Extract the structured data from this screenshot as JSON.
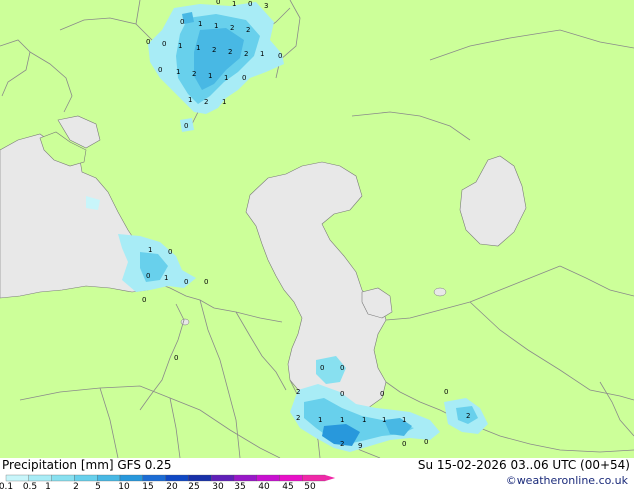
{
  "footer": {
    "title": "Precipitation [mm]  GFS 0.25",
    "datetime": "Su 15-02-2026 03..06 UTC (00+54)",
    "credit": "©weatheronline.co.uk"
  },
  "legend": {
    "ticks": [
      "0.1",
      "0.5",
      "1",
      "2",
      "5",
      "10",
      "15",
      "20",
      "25",
      "30",
      "35",
      "40",
      "45",
      "50"
    ],
    "colors": [
      "#c8f5fa",
      "#a8ecf6",
      "#88e0f0",
      "#68d0ec",
      "#48b8e4",
      "#2898dc",
      "#1c6cd4",
      "#1048c4",
      "#1830a8",
      "#6020b8",
      "#9818c8",
      "#c810d0",
      "#e810c8",
      "#f028a8"
    ]
  },
  "colors": {
    "land": "#ccff99",
    "water": "#e8e8e8",
    "border": "#8a8a8a",
    "coast": "#7a7a7a"
  },
  "precip_values": [
    {
      "text": "0"
    },
    {
      "text": "1"
    },
    {
      "text": "0"
    },
    {
      "text": "3"
    },
    {
      "text": "0"
    },
    {
      "text": "1"
    },
    {
      "text": "1"
    },
    {
      "text": "2"
    },
    {
      "text": "2"
    },
    {
      "text": "0"
    },
    {
      "text": "0"
    },
    {
      "text": "1"
    },
    {
      "text": "1"
    },
    {
      "text": "2"
    },
    {
      "text": "2"
    },
    {
      "text": "2"
    },
    {
      "text": "1"
    },
    {
      "text": "0"
    },
    {
      "text": "0"
    },
    {
      "text": "1"
    },
    {
      "text": "2"
    },
    {
      "text": "1"
    },
    {
      "text": "1"
    },
    {
      "text": "0"
    },
    {
      "text": "1"
    },
    {
      "text": "2"
    },
    {
      "text": "1"
    },
    {
      "text": "0"
    },
    {
      "text": "1"
    },
    {
      "text": "0"
    },
    {
      "text": "0"
    },
    {
      "text": "1"
    },
    {
      "text": "0"
    },
    {
      "text": "0"
    },
    {
      "text": "0"
    },
    {
      "text": "0"
    },
    {
      "text": "0"
    },
    {
      "text": "0"
    },
    {
      "text": "2"
    },
    {
      "text": "0"
    },
    {
      "text": "0"
    },
    {
      "text": "2"
    },
    {
      "text": "1"
    },
    {
      "text": "1"
    },
    {
      "text": "1"
    },
    {
      "text": "1"
    },
    {
      "text": "1"
    },
    {
      "text": "0"
    },
    {
      "text": "2"
    },
    {
      "text": "2"
    },
    {
      "text": "9"
    },
    {
      "text": "0"
    },
    {
      "text": "0"
    }
  ]
}
